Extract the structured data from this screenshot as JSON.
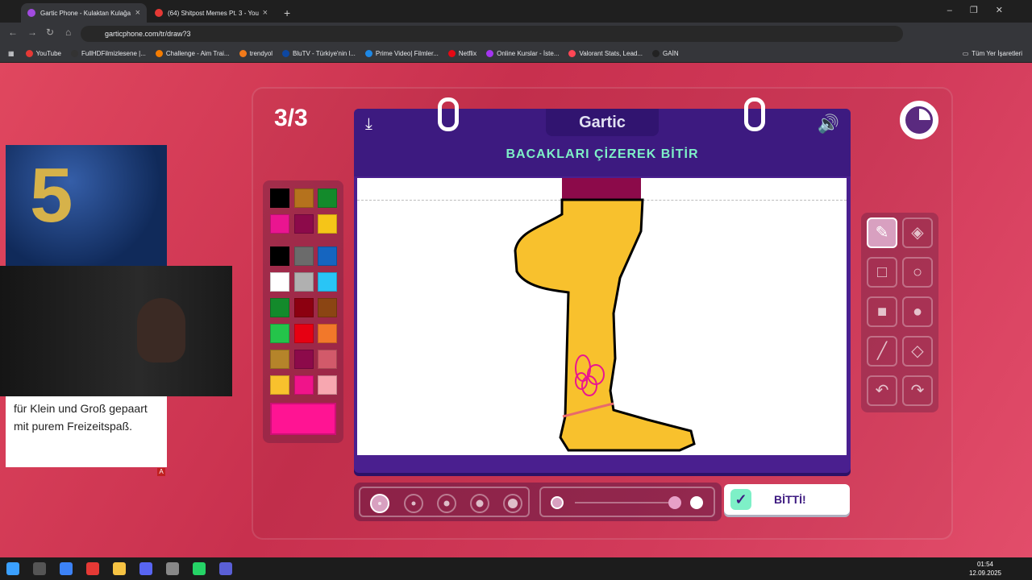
{
  "browser": {
    "tabs": [
      {
        "title": "Gartic Phone - Kulaktan Kulağa",
        "active": true
      },
      {
        "title": "(64) Shitpost Memes Pt. 3 - You",
        "active": false
      }
    ],
    "url": "garticphone.com/tr/draw?3",
    "bookmarks": [
      "YouTube",
      "FullHDFilmizlesene |...",
      "Challenge - Aim Trai...",
      "trendyol",
      "BluTV - Türkiye'nin l...",
      "Prime Video| Filmler...",
      "Netflix",
      "Online Kurslar - İste...",
      "Valorant Stats, Lead...",
      "GAİN"
    ],
    "all_bookmarks": "Tüm Yer İşaretleri"
  },
  "game": {
    "round": "3/3",
    "logo": "Gartic",
    "prompt": "BACAKLARI ÇİZEREK BİTİR",
    "done_label": "BİTTİ!",
    "palette_colors": [
      "#000000",
      "#b5721d",
      "#138a2b",
      "#ea1590",
      "#8c0a4a",
      "#f5c518",
      "#000000",
      "#6b6b6b",
      "#1565c0",
      "#ffffff",
      "#b0b0b0",
      "#29c5f6",
      "#138a2b",
      "#8c0010",
      "#8b4513",
      "#24c44a",
      "#e60012",
      "#f2782a",
      "#b5842a",
      "#8c0a4a",
      "#d25a6a",
      "#f8c12d",
      "#f0148a",
      "#f7a7b0"
    ],
    "selected_color": "#ff1493"
  },
  "ad": {
    "headline": "5",
    "text": "für Klein und Groß gepaart mit purem Freizeitspaß."
  },
  "taskbar": {
    "time": "01:54",
    "date": "12.09.2025"
  }
}
